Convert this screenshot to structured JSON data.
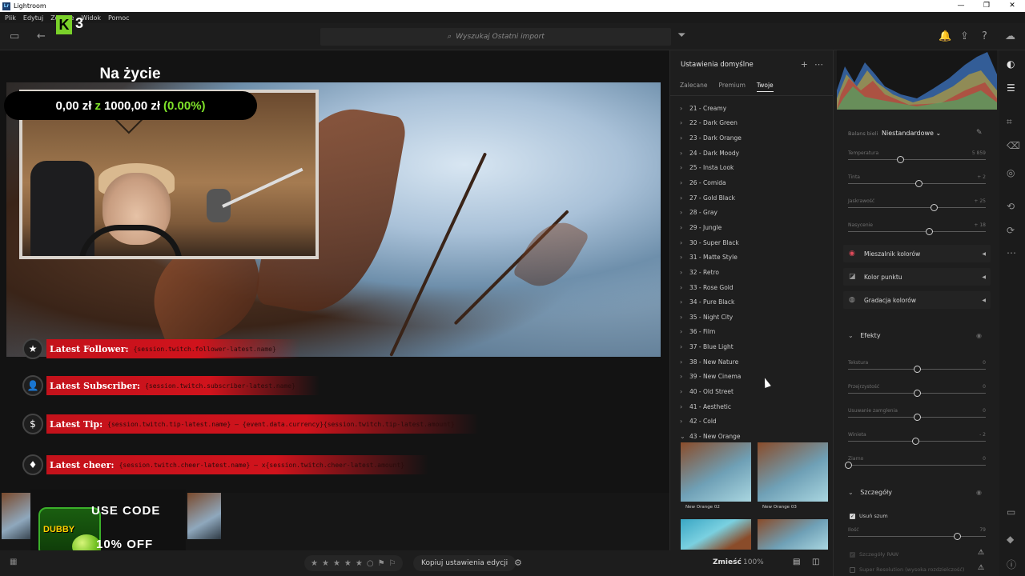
{
  "window": {
    "title": "Lightroom",
    "controls": [
      "—",
      "❐",
      "✕"
    ]
  },
  "menu": [
    "Plik",
    "Edytuj",
    "Zdjęcie",
    "Widok",
    "Pomoc"
  ],
  "overlay_badge": {
    "letter": "K",
    "number": "3"
  },
  "search": {
    "placeholder": "Wyszukaj Ostatni import"
  },
  "stream": {
    "title": "Na życie",
    "goal_current": "0,00 zł",
    "goal_sep": "z",
    "goal_target": "1000,00 zł",
    "goal_pct": "(0.00%)",
    "goal_progress": 0.0,
    "alerts": [
      {
        "label": "Latest Follower:",
        "placeholder": "{session.twitch.follower-latest.name}",
        "icon": "star-icon",
        "glyph": "★"
      },
      {
        "label": "Latest Subscriber:",
        "placeholder": "{session.twitch.subscriber-latest.name}",
        "icon": "person-icon",
        "glyph": "👤"
      },
      {
        "label": "Latest Tip:",
        "placeholder": "{session.twitch.tip-latest.name} — {event.data.currency}{session.twitch.tip-latest.amount}",
        "icon": "dollar-icon",
        "glyph": "$"
      },
      {
        "label": "Latest cheer:",
        "placeholder": "{session.twitch.cheer-latest.name} — x{session.twitch.cheer-latest.amount}",
        "icon": "diamond-icon",
        "glyph": "♦"
      }
    ],
    "promo": {
      "line1": "USE CODE",
      "line2": "10% OFF",
      "can_text": "DUBBY"
    }
  },
  "presets_panel": {
    "title": "Ustawienia domyślne",
    "tabs": [
      "Zalecane",
      "Premium",
      "Twoje"
    ],
    "active_tab": "Twoje",
    "items": [
      "21 - Creamy",
      "22 - Dark Green",
      "23 - Dark Orange",
      "24 - Dark Moody",
      "25 - Insta Look",
      "26 - Comida",
      "27 - Gold Black",
      "28 - Gray",
      "29 - Jungle",
      "30 - Super Black",
      "31 - Matte Style",
      "32 - Retro",
      "33 - Rose Gold",
      "34 - Pure Black",
      "35 - Night City",
      "36 - Film",
      "37 - Blue Light",
      "38 - New Nature",
      "39 - New Cinema",
      "40 - Old Street",
      "41 - Aesthetic",
      "42 - Cold",
      "43 - New Orange"
    ],
    "expanded_item": "43 - New Orange",
    "thumbs": [
      "New Orange 02",
      "New Orange 03"
    ]
  },
  "edit_panel": {
    "wb_label": "Balans bieli",
    "wb_value": "Niestandardowe",
    "color_sliders": [
      {
        "label": "Temperatura",
        "value": "5 859",
        "pos": 0.38
      },
      {
        "label": "Tinta",
        "value": "+ 2",
        "pos": 0.51
      },
      {
        "label": "Jaskrawość",
        "value": "+ 25",
        "pos": 0.62
      },
      {
        "label": "Nasycenie",
        "value": "+ 18",
        "pos": 0.59
      }
    ],
    "sections": [
      {
        "label": "Mieszalnik kolorów",
        "icon": "color-mixer-icon"
      },
      {
        "label": "Kolor punktu",
        "icon": "point-color-icon"
      },
      {
        "label": "Gradacja kolorów",
        "icon": "color-grading-icon"
      }
    ],
    "effects_title": "Efekty",
    "effects_sliders": [
      {
        "label": "Tekstura",
        "value": "0",
        "pos": 0.5
      },
      {
        "label": "Przejrzystość",
        "value": "0",
        "pos": 0.5
      },
      {
        "label": "Usuwanie zamglenia",
        "value": "0",
        "pos": 0.5
      },
      {
        "label": "Winieta",
        "value": "- 2",
        "pos": 0.49
      },
      {
        "label": "Ziarno",
        "value": "0",
        "pos": 0.0
      }
    ],
    "details_title": "Szczegóły",
    "denoise_label": "Usuń szum",
    "amount_label": "Ilość",
    "amount_value": "79",
    "amount_pos": 0.79,
    "raw_label": "Szczegóły RAW",
    "superres_label": "Super Resolution (wysoka rozdzielczość)"
  },
  "bottom": {
    "copy_label": "Kopiuj ustawienia edycji",
    "fit_label": "Zmieść",
    "zoom_label": "100%"
  }
}
